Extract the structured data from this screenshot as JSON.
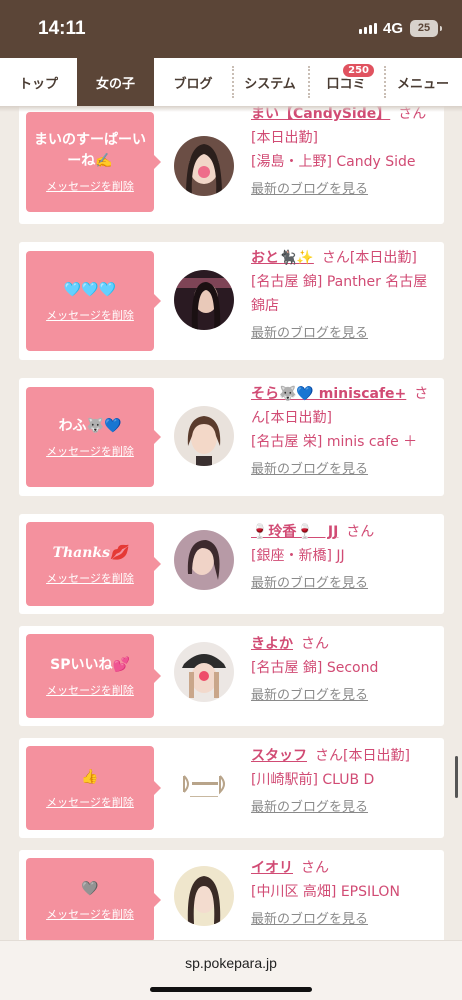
{
  "status_bar": {
    "time": "14:11",
    "network": "4G",
    "battery": "25"
  },
  "nav": {
    "tabs": [
      {
        "label": "トップ",
        "active": false
      },
      {
        "label": "女の子",
        "active": true
      },
      {
        "label": "ブログ",
        "active": false
      },
      {
        "label": "システム",
        "active": false
      },
      {
        "label": "口コミ",
        "active": false,
        "badge": "250"
      },
      {
        "label": "メニュー",
        "active": false
      }
    ]
  },
  "items": [
    {
      "message": "まいのすーぱーいーね✍️",
      "delete_label": "メッセージを削除",
      "name": "まい【CandySide】",
      "honorific": "さん",
      "status": "[本日出勤]",
      "shop": "[湯島・上野] Candy Side",
      "blog_link": "最新のブログを見る"
    },
    {
      "message": "🩵🩵🩵",
      "delete_label": "メッセージを削除",
      "name": "おと🐈‍⬛✨",
      "honorific": "さん",
      "status": "[本日出勤]",
      "shop": "[名古屋 錦] Panther 名古屋 錦店",
      "blog_link": "最新のブログを見る"
    },
    {
      "message": "わふ🐺💙",
      "delete_label": "メッセージを削除",
      "name": "そら🐺💙 miniscafe+",
      "honorific": "さん",
      "status": "[本日出勤]",
      "shop": "[名古屋 栄] minis cafe ＋",
      "blog_link": "最新のブログを見る"
    },
    {
      "message": "Thanks💋",
      "delete_label": "メッセージを削除",
      "name": "🍷玲香🍷　JJ",
      "honorific": "さん",
      "status": "",
      "shop": "[銀座・新橋] JJ",
      "blog_link": "最新のブログを見る"
    },
    {
      "message": "SPいいね💕",
      "delete_label": "メッセージを削除",
      "name": "きよか",
      "honorific": "さん",
      "status": "",
      "shop": "[名古屋 錦] Second",
      "blog_link": "最新のブログを見る"
    },
    {
      "message": "👍",
      "delete_label": "メッセージを削除",
      "name": "スタッフ",
      "honorific": "さん",
      "status": "[本日出勤]",
      "shop": "[川崎駅前] CLUB D",
      "blog_link": "最新のブログを見る"
    },
    {
      "message": "🩶",
      "delete_label": "メッセージを削除",
      "name": "イオリ",
      "honorific": "さん",
      "status": "",
      "shop": "[中川区 高畑] EPSILON",
      "blog_link": "最新のブログを見る"
    }
  ],
  "bottom_bar": {
    "url": "sp.pokepara.jp"
  },
  "colors": {
    "header": "#5b4537",
    "bubble": "#f4919e",
    "accent_text": "#d14b74",
    "badge": "#e0525f"
  }
}
